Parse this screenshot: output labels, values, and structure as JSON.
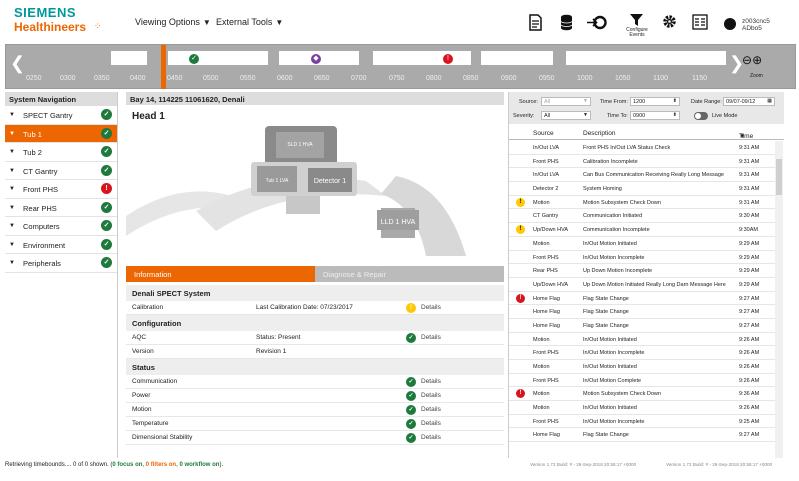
{
  "header": {
    "brand_line1": "SIEMENS",
    "brand_line2": "Healthineers",
    "menus": [
      "Viewing Options",
      "External Tools"
    ],
    "configure_label": "Configure Events",
    "user_name_line1": "z003cnc5",
    "user_name_line2": "ADbo5"
  },
  "timeline": {
    "labels": [
      "0250",
      "0300",
      "0350",
      "0400",
      "0450",
      "0500",
      "0550",
      "0600",
      "0650",
      "0700",
      "0750",
      "0800",
      "0850",
      "0900",
      "0950",
      "1000",
      "1050",
      "1100",
      "1150"
    ],
    "zoom_label": "Zoom",
    "accent": "#ec6602"
  },
  "nav": {
    "title": "System Navigation",
    "items": [
      {
        "label": "SPECT Gantry",
        "status": "ok"
      },
      {
        "label": "Tub 1",
        "status": "ok"
      },
      {
        "label": "Tub 2",
        "status": "ok"
      },
      {
        "label": "CT Gantry",
        "status": "ok"
      },
      {
        "label": "Front PHS",
        "status": "err"
      },
      {
        "label": "Rear PHS",
        "status": "ok"
      },
      {
        "label": "Computers",
        "status": "ok"
      },
      {
        "label": "Environment",
        "status": "ok"
      },
      {
        "label": "Peripherals",
        "status": "ok"
      }
    ]
  },
  "center": {
    "title": "Bay 14, 114225 11061620, Denali",
    "head_title": "Head 1",
    "scene_labels": {
      "sld": "SLD 1 HVA",
      "tub": "Tub 1 LVA",
      "det": "Detector 1",
      "lld": "LLD 1 HVA"
    },
    "tab_info": "Information",
    "tab_diag": "Diagnose & Repair",
    "system_title": "Denali SPECT System",
    "calibration": {
      "label": "Calibration",
      "value": "Last Calibration Date: 07/23/2017",
      "detail": "Details"
    },
    "config_title": "Configuration",
    "aqc": {
      "label": "AQC",
      "value": "Status: Present",
      "detail": "Details"
    },
    "version": {
      "label": "Version",
      "value": "Revision 1"
    },
    "status_title": "Status",
    "status_rows": [
      {
        "label": "Communication",
        "detail": "Details"
      },
      {
        "label": "Power",
        "detail": "Details"
      },
      {
        "label": "Motion",
        "detail": "Details"
      },
      {
        "label": "Temperature",
        "detail": "Details"
      },
      {
        "label": "Dimensional Stability",
        "detail": "Details"
      }
    ]
  },
  "events": {
    "filters": {
      "source_label": "Source:",
      "source_value": "All",
      "severity_label": "Severity:",
      "severity_value": "All",
      "time_from_label": "Time From:",
      "time_from_value": "1200",
      "time_to_label": "Time To:",
      "time_to_value": "0900",
      "date_range_label": "Date Range:",
      "date_range_value": "09/07-09/12",
      "live_mode_label": "Live Mode"
    },
    "headers": {
      "source": "Source",
      "description": "Description",
      "time": "Time"
    },
    "rows": [
      {
        "sev": "",
        "source": "In/Out LVA",
        "desc": "Front PHS In/Out LVA Status Check",
        "time": "9:31 AM"
      },
      {
        "sev": "",
        "source": "Front PHS",
        "desc": "Calibration Incomplete",
        "time": "9:31 AM"
      },
      {
        "sev": "",
        "source": "In/Out LVA",
        "desc": "Can Bus Communication Receiving Really Long Message",
        "time": "9:31 AM"
      },
      {
        "sev": "",
        "source": "Detector 2",
        "desc": "System Homing",
        "time": "9:31 AM"
      },
      {
        "sev": "warn",
        "source": "Motion",
        "desc": "Motion Subsystem Check Down",
        "time": "9:31 AM"
      },
      {
        "sev": "",
        "source": "CT Gantry",
        "desc": "Communication Initiated",
        "time": "9:30 AM"
      },
      {
        "sev": "warn",
        "source": "Up/Down HVA",
        "desc": "Communication Incomplete",
        "time": "9:30AM"
      },
      {
        "sev": "",
        "source": "Motion",
        "desc": "In/Out Motion Initiated",
        "time": "9:29 AM"
      },
      {
        "sev": "",
        "source": "Front PHS",
        "desc": "In/Out Motion Incomplete",
        "time": "9:29 AM"
      },
      {
        "sev": "",
        "source": "Rear PHS",
        "desc": "Up Down Motion Incomplete",
        "time": "9:29 AM"
      },
      {
        "sev": "",
        "source": "Up/Down HVA",
        "desc": "Up Down Motion Initiated Really Long Darn Message Here",
        "time": "9:29 AM"
      },
      {
        "sev": "err",
        "source": "Home Flag",
        "desc": "Flag State Change",
        "time": "9:27 AM"
      },
      {
        "sev": "",
        "source": "Home Flag",
        "desc": "Flag State Change",
        "time": "9:27 AM"
      },
      {
        "sev": "",
        "source": "Home Flag",
        "desc": "Flag State Change",
        "time": "9:27 AM"
      },
      {
        "sev": "",
        "source": "Motion",
        "desc": "In/Out Motion Initiated",
        "time": "9:26 AM"
      },
      {
        "sev": "",
        "source": "Front PHS",
        "desc": "In/Out Motion Incomplete",
        "time": "9:26 AM"
      },
      {
        "sev": "",
        "source": "Motion",
        "desc": "In/Out Motion Initiated",
        "time": "9:26 AM"
      },
      {
        "sev": "",
        "source": "Front PHS",
        "desc": "In/Out Motion Complete",
        "time": "9:26 AM"
      },
      {
        "sev": "err",
        "source": "Motion",
        "desc": "Motion Subsystem Check Down",
        "time": "9:36 AM"
      },
      {
        "sev": "",
        "source": "Motion",
        "desc": "In/Out Motion Initiated",
        "time": "9:26 AM"
      },
      {
        "sev": "",
        "source": "Front PHS",
        "desc": "In/Out Motion Incomplete",
        "time": "9:25 AM"
      },
      {
        "sev": "",
        "source": "Home Flag",
        "desc": "Flag State Change",
        "time": "9:27 AM"
      }
    ]
  },
  "footer": {
    "prefix": "Retrieving timebounds.... 0 of 0 shown. (",
    "focus": "0 focus on",
    "sep1": ", ",
    "filters": "0 filters on",
    "sep2": ", ",
    "workflow": "0 workflow on",
    "suffix": ").",
    "version1": "Version 1.72 Build: # - 26-Sep-2018 20:55:17 +0000",
    "version2": "Version 1.72 Build: # - 26-Sep-2018 20:55:17 +0000"
  }
}
